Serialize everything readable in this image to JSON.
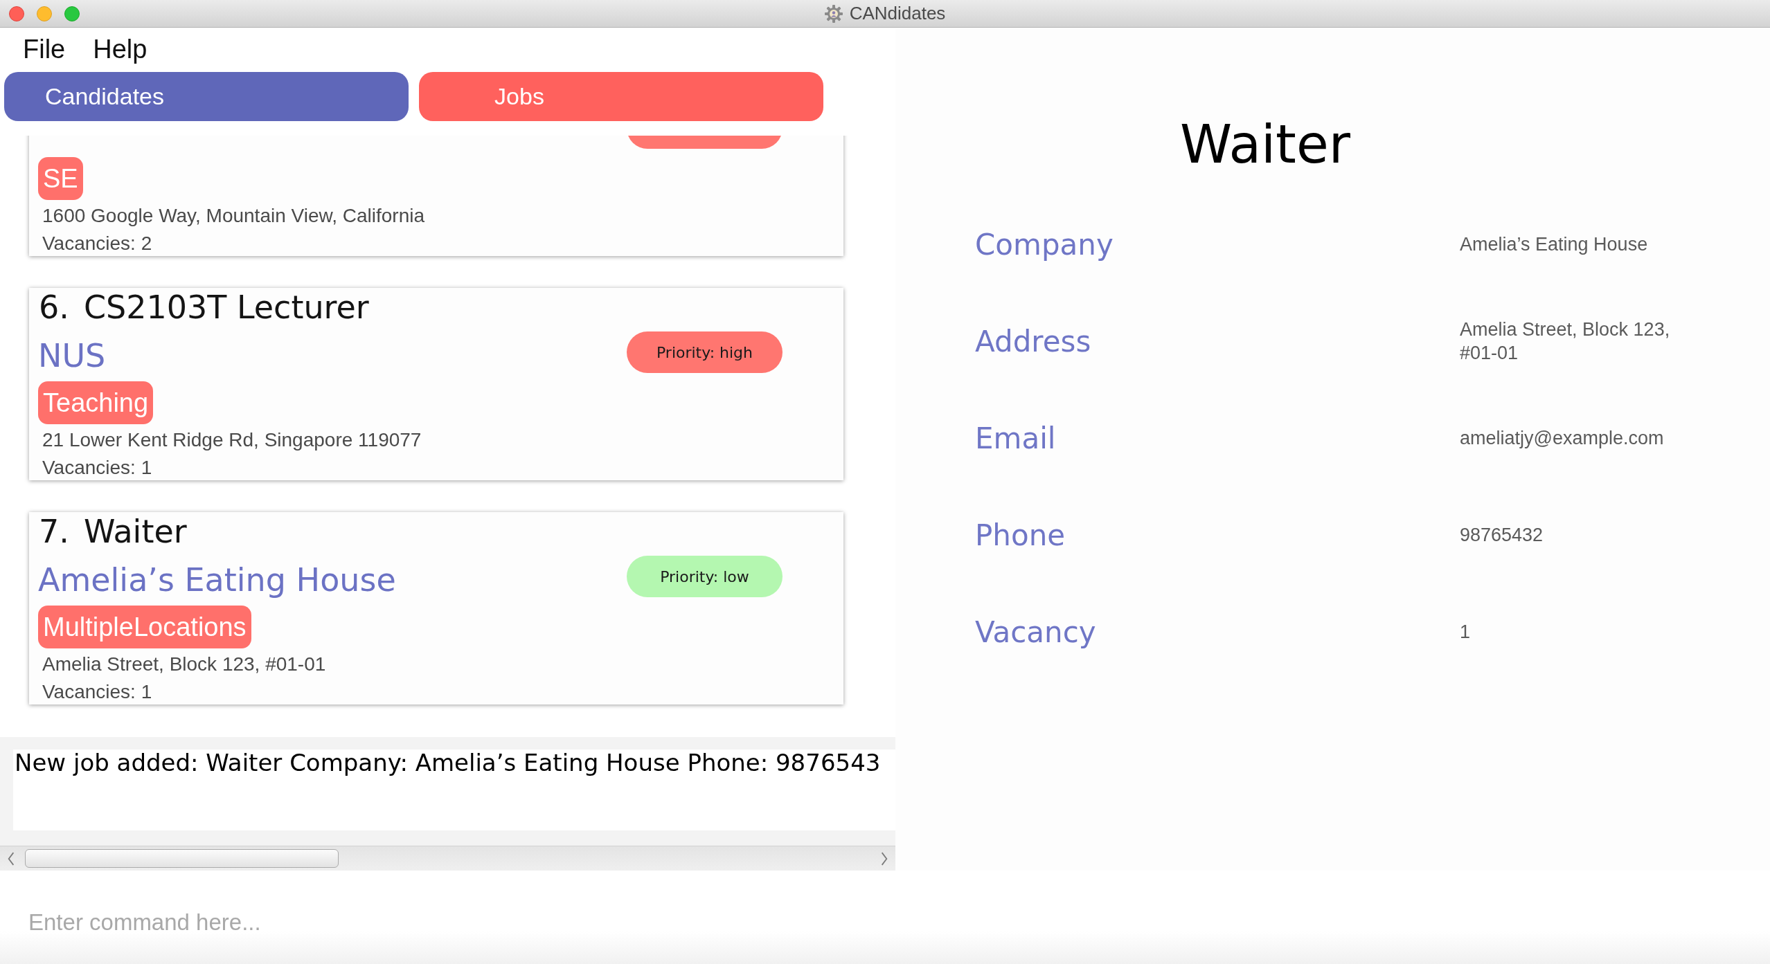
{
  "window": {
    "title": "CANdidates"
  },
  "menu": [
    "File",
    "Help"
  ],
  "tabs": [
    {
      "label": "Candidates",
      "selected": false
    },
    {
      "label": "Jobs",
      "selected": true
    }
  ],
  "jobs": [
    {
      "tags": [
        "SE"
      ],
      "address": "1600 Google Way, Mountain View, California",
      "vacancies": "Vacancies: 2",
      "high_priority": true
    },
    {
      "index": "6.",
      "title": "CS2103T Lecturer",
      "company": "NUS",
      "tags": [
        "Teaching"
      ],
      "address": "21 Lower Kent Ridge Rd, Singapore 119077",
      "vacancies": "Vacancies: 1",
      "high_priority": true,
      "priority_label": "Priority: high"
    },
    {
      "index": "7.",
      "title": "Waiter",
      "company": "Amelia’s Eating House",
      "tags": [
        "MultipleLocations"
      ],
      "address": "Amelia Street, Block 123, #01-01",
      "vacancies": "Vacancies: 1",
      "high_priority": false,
      "priority_label": "Priority: low"
    }
  ],
  "result_display": {
    "text": "New job added: Waiter Company: Amelia’s Eating House Phone: 9876543"
  },
  "command_box": {
    "placeholder": "Enter command here..."
  },
  "detail": {
    "title": "Waiter",
    "fields": [
      {
        "label": "Company",
        "value": "Amelia’s Eating House"
      },
      {
        "label": "Address",
        "value": "Amelia Street, Block 123, #01-01"
      },
      {
        "label": "Email",
        "value": "ameliatjy@example.com"
      },
      {
        "label": "Phone",
        "value": "98765432"
      },
      {
        "label": "Vacancy",
        "value": "1"
      }
    ]
  }
}
